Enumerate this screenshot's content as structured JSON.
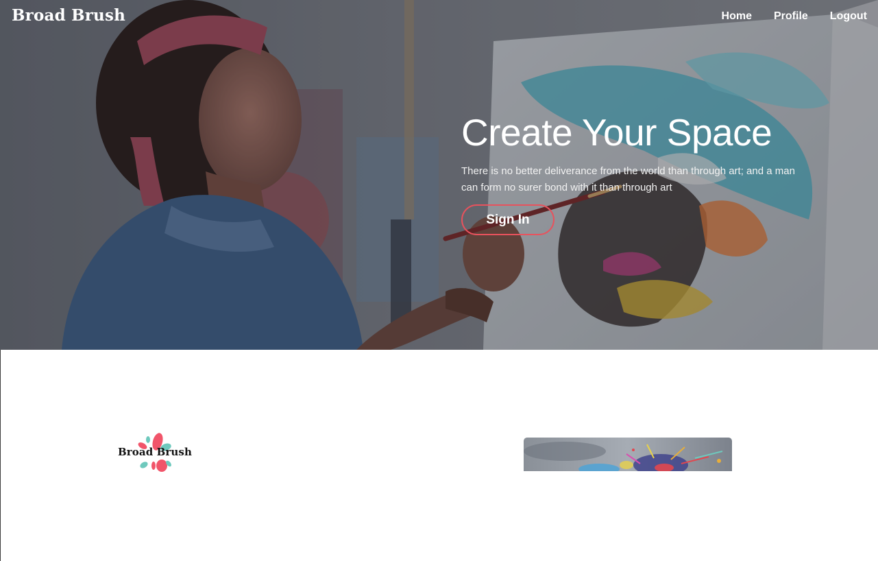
{
  "nav": {
    "brand": "Broad Brush",
    "links": [
      "Home",
      "Profile",
      "Logout"
    ]
  },
  "hero": {
    "title": "Create Your Space",
    "subtitle": "There is no better deliverance from the world than through art; and a man can form no surer bond with it than through art",
    "cta": "Sign In"
  },
  "logo": {
    "text": "Broad Brush"
  },
  "colors": {
    "accent": "#e8525d",
    "logo_pink": "#f1556a",
    "logo_teal": "#6ec9bd",
    "text_white": "#ffffff"
  }
}
